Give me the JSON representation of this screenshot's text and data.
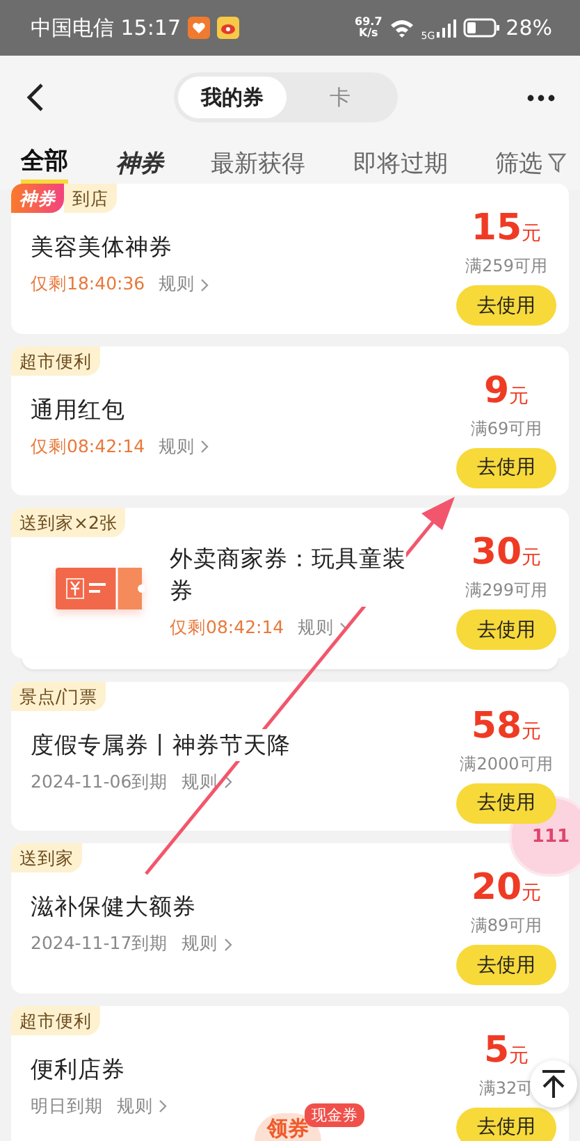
{
  "status_bar": {
    "carrier_time": "中国电信 15:17",
    "speed": "69.7",
    "speed_unit": "K/s",
    "network": "5G",
    "battery": "28%"
  },
  "header": {
    "segments": [
      {
        "label": "我的券",
        "selected": true
      },
      {
        "label": "卡",
        "selected": false
      }
    ]
  },
  "tabs": [
    {
      "label": "全部",
      "selected": true,
      "kind": "text"
    },
    {
      "label": "神券",
      "selected": false,
      "kind": "brand"
    },
    {
      "label": "最新获得",
      "selected": false,
      "kind": "text"
    },
    {
      "label": "即将过期",
      "selected": false,
      "kind": "text"
    }
  ],
  "filter": {
    "label": "筛选"
  },
  "coupons": [
    {
      "kind": "standard",
      "tags": [
        {
          "label": "神券",
          "kind": "brand"
        },
        {
          "label": "到店",
          "kind": "plain"
        }
      ],
      "title": "美容美体神券",
      "validity": {
        "text": "仅剩18:40:36",
        "kind": "countdown"
      },
      "rules": "规则",
      "amount": "15",
      "unit": "元",
      "condition": "满259可用",
      "action": "去使用",
      "stacked": false
    },
    {
      "kind": "standard",
      "tags": [
        {
          "label": "超市便利",
          "kind": "plain"
        }
      ],
      "title": "通用红包",
      "validity": {
        "text": "仅剩08:42:14",
        "kind": "countdown"
      },
      "rules": "规则",
      "amount": "9",
      "unit": "元",
      "condition": "满69可用",
      "action": "去使用",
      "stacked": false
    },
    {
      "kind": "merchant",
      "tags": [
        {
          "label": "送到家×2张",
          "kind": "plain"
        }
      ],
      "title": "外卖商家券：玩具童装券",
      "validity": {
        "text": "仅剩08:42:14",
        "kind": "countdown"
      },
      "rules": "规则",
      "amount": "30",
      "unit": "元",
      "condition": "满299可用",
      "action": "去使用",
      "stacked": true
    },
    {
      "kind": "standard",
      "tags": [
        {
          "label": "景点/门票",
          "kind": "plain"
        }
      ],
      "title": "度假专属券丨神券节天降",
      "validity": {
        "text": "2024-11-06到期",
        "kind": "date"
      },
      "rules": "规则",
      "amount": "58",
      "unit": "元",
      "condition": "满2000可用",
      "action": "去使用",
      "stacked": false
    },
    {
      "kind": "standard",
      "tags": [
        {
          "label": "送到家",
          "kind": "plain"
        }
      ],
      "title": "滋补保健大额券",
      "validity": {
        "text": "2024-11-17到期",
        "kind": "date"
      },
      "rules": "规则",
      "amount": "20",
      "unit": "元",
      "condition": "满89可用",
      "action": "去使用",
      "stacked": false
    },
    {
      "kind": "standard",
      "tags": [
        {
          "label": "超市便利",
          "kind": "plain"
        }
      ],
      "title": "便利店券",
      "validity": {
        "text": "明日到期",
        "kind": "date"
      },
      "rules": "规则",
      "amount": "5",
      "unit": "元",
      "condition": "满32可",
      "action": "去使用",
      "stacked": false
    }
  ],
  "floating": {
    "badge": "111",
    "promo": "领券",
    "promo_tag": "现金券"
  }
}
